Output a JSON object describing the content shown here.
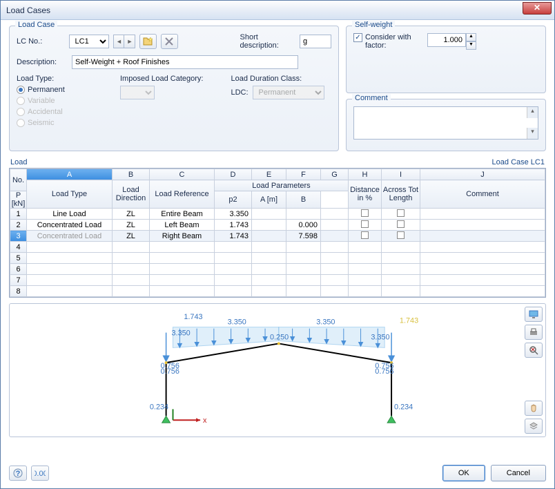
{
  "window": {
    "title": "Load Cases"
  },
  "groups": {
    "loadcase": "Load Case",
    "selfweight": "Self-weight",
    "comment": "Comment",
    "load": "Load",
    "load_right": "Load Case LC1"
  },
  "loadcase": {
    "lcno_label": "LC No.:",
    "lcno_value": "LC1",
    "shortdesc_label": "Short description:",
    "shortdesc_value": "g",
    "desc_label": "Description:",
    "desc_value": "Self-Weight + Roof Finishes",
    "loadtype_label": "Load Type:",
    "ilc_label": "Imposed Load Category:",
    "ldc_label": "Load Duration Class:",
    "ldc_sub": "LDC:",
    "ldc_value": "Permanent",
    "radios": {
      "permanent": "Permanent",
      "variable": "Variable",
      "accidental": "Accidental",
      "seismic": "Seismic"
    }
  },
  "selfweight": {
    "consider_label": "Consider with factor:",
    "factor_value": "1.000"
  },
  "grid": {
    "col_letters": [
      "A",
      "B",
      "C",
      "D",
      "E",
      "F",
      "G",
      "H",
      "I",
      "J"
    ],
    "headers": {
      "no": "No.",
      "loadtype": "Load Type",
      "loaddir": "Load Direction",
      "loadref": "Load Reference",
      "loadparams": "Load Parameters",
      "p": "P [kN]",
      "p2": "p2",
      "a": "A [m]",
      "b": "B",
      "dist": "Distance in %",
      "across": "Across Tot Length",
      "comment": "Comment"
    },
    "rows": [
      {
        "n": "1",
        "type": "Line Load",
        "dir": "ZL",
        "ref": "Entire Beam",
        "p": "3.350",
        "p2": "",
        "a": "",
        "b": ""
      },
      {
        "n": "2",
        "type": "Concentrated Load",
        "dir": "ZL",
        "ref": "Left Beam",
        "p": "1.743",
        "p2": "",
        "a": "0.000",
        "b": ""
      },
      {
        "n": "3",
        "type": "Concentrated Load",
        "dir": "ZL",
        "ref": "Right Beam",
        "p": "1.743",
        "p2": "",
        "a": "7.598",
        "b": ""
      },
      {
        "n": "4"
      },
      {
        "n": "5"
      },
      {
        "n": "6"
      },
      {
        "n": "7"
      },
      {
        "n": "8"
      }
    ]
  },
  "diagram": {
    "labels": {
      "l1743_1": "1.743",
      "l1743_2": "1.743",
      "l3350_1": "3.350",
      "l3350_2": "3.350",
      "l3350_3": "3.350",
      "l3350_4": "3.350",
      "l0250": "0.250",
      "l0756_1": "0.756",
      "l0756_2": "0.756",
      "l0756_3": "0.756",
      "l0756_4": "0.756",
      "l0234_1": "0.234",
      "l0234_2": "0.234",
      "x": "x"
    }
  },
  "footer": {
    "ok": "OK",
    "cancel": "Cancel"
  }
}
